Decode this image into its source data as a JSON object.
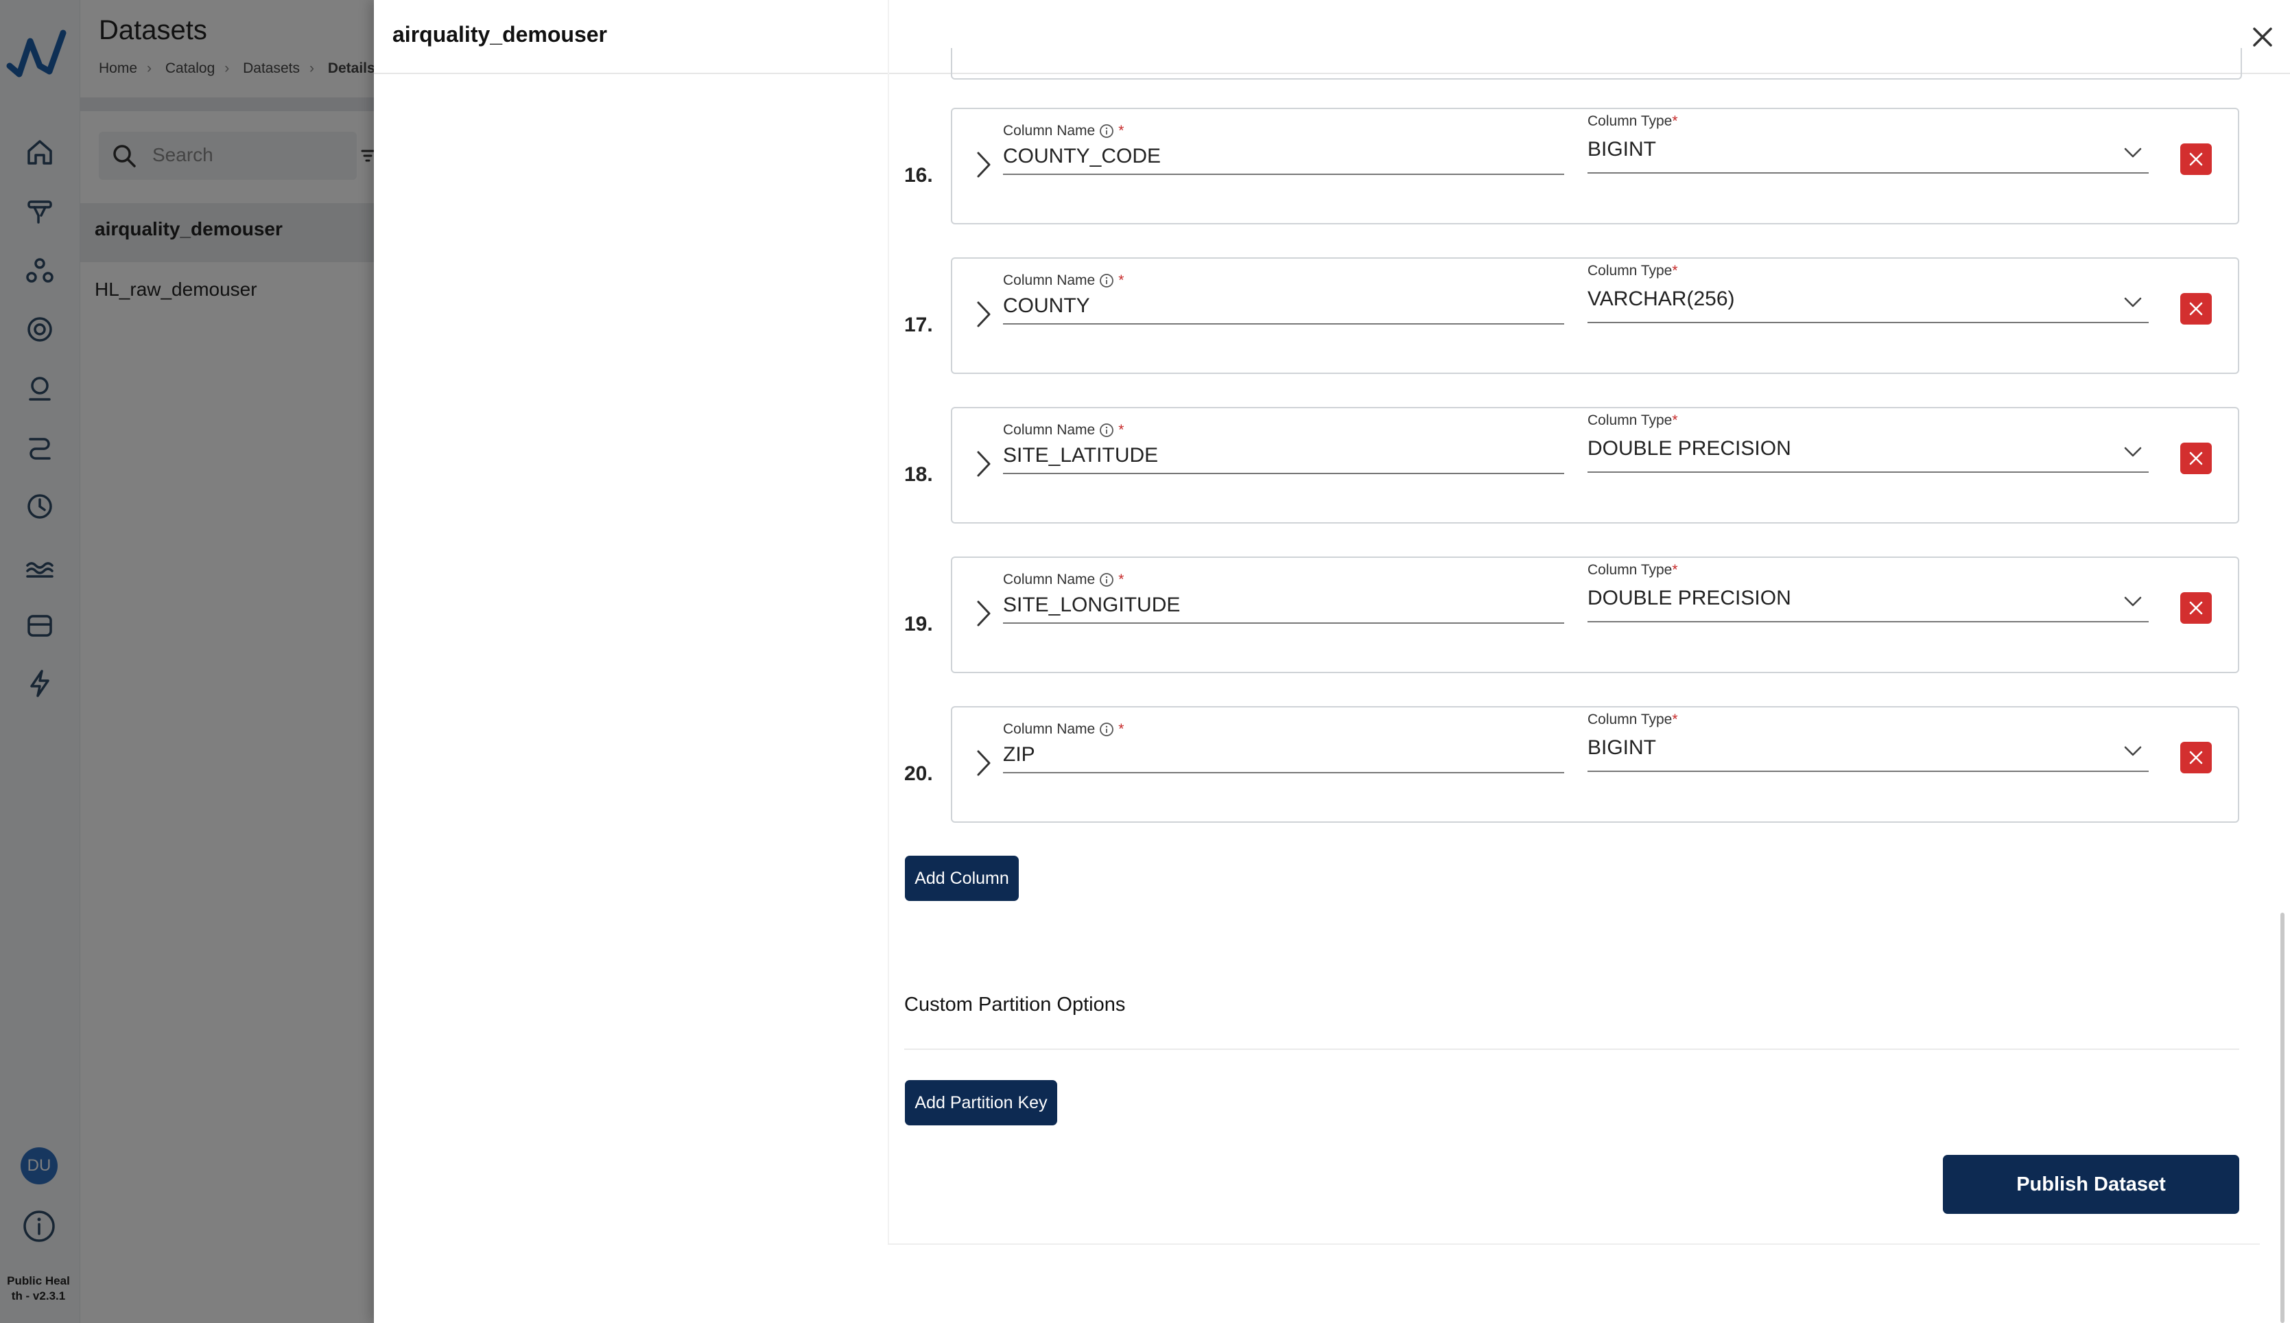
{
  "app": {
    "version": "Public Health - v2.3.1",
    "version_line1": "Public Heal",
    "version_line2": "th - v2.3.1",
    "user_initials": "DU"
  },
  "rail": {
    "icons": [
      "home-icon",
      "pipelines-icon",
      "network-icon",
      "target-icon",
      "user-icon",
      "workflow-icon",
      "clock-icon",
      "lake-icon",
      "storage-icon",
      "lightning-icon"
    ]
  },
  "background_page": {
    "title": "Datasets",
    "breadcrumb": [
      "Home",
      "Catalog",
      "Datasets",
      "Details"
    ],
    "search_placeholder": "Search",
    "list": [
      "airquality_demouser",
      "HL_raw_demouser"
    ]
  },
  "drawer": {
    "title": "airquality_demouser",
    "column_name_label": "Column Name",
    "column_type_label": "Column Type",
    "required_mark": "*",
    "columns": [
      {
        "num": "16.",
        "name": "COUNTY_CODE",
        "type": "BIGINT"
      },
      {
        "num": "17.",
        "name": "COUNTY",
        "type": "VARCHAR(256)"
      },
      {
        "num": "18.",
        "name": "SITE_LATITUDE",
        "type": "DOUBLE PRECISION"
      },
      {
        "num": "19.",
        "name": "SITE_LONGITUDE",
        "type": "DOUBLE PRECISION"
      },
      {
        "num": "20.",
        "name": "ZIP",
        "type": "BIGINT"
      }
    ],
    "add_column": "Add Column",
    "partition_title": "Custom Partition Options",
    "add_partition": "Add Partition Key",
    "publish": "Publish Dataset"
  },
  "colors": {
    "primary": "#0d2a52",
    "danger": "#d32f2f",
    "avatar": "#2f6fbf"
  }
}
